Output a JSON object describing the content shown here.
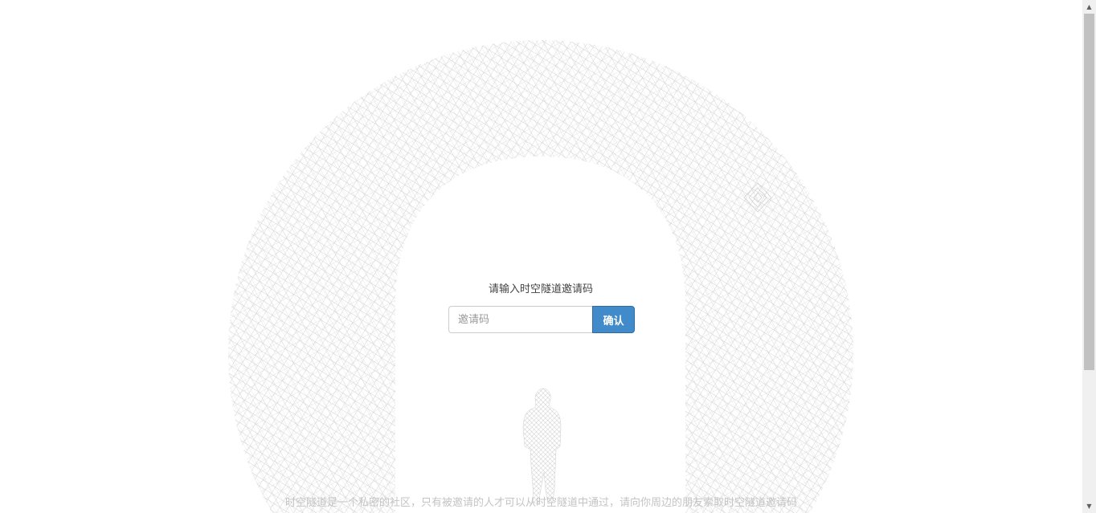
{
  "invite": {
    "title": "请输入时空隧道邀请码",
    "input_placeholder": "邀请码",
    "input_value": "",
    "confirm_label": "确认"
  },
  "footer": {
    "note": "时空隧道是一个私密的社区，只有被邀请的人才可以从时空隧道中通过，请向你周边的朋友索取时空隧道邀请码"
  },
  "colors": {
    "accent": "#428bca",
    "mesh": "#c8c8c8",
    "footer_text": "#c4c4c4"
  },
  "icons": {
    "scroll_up": "scroll-up-arrow-icon",
    "scroll_down": "scroll-down-arrow-icon"
  }
}
